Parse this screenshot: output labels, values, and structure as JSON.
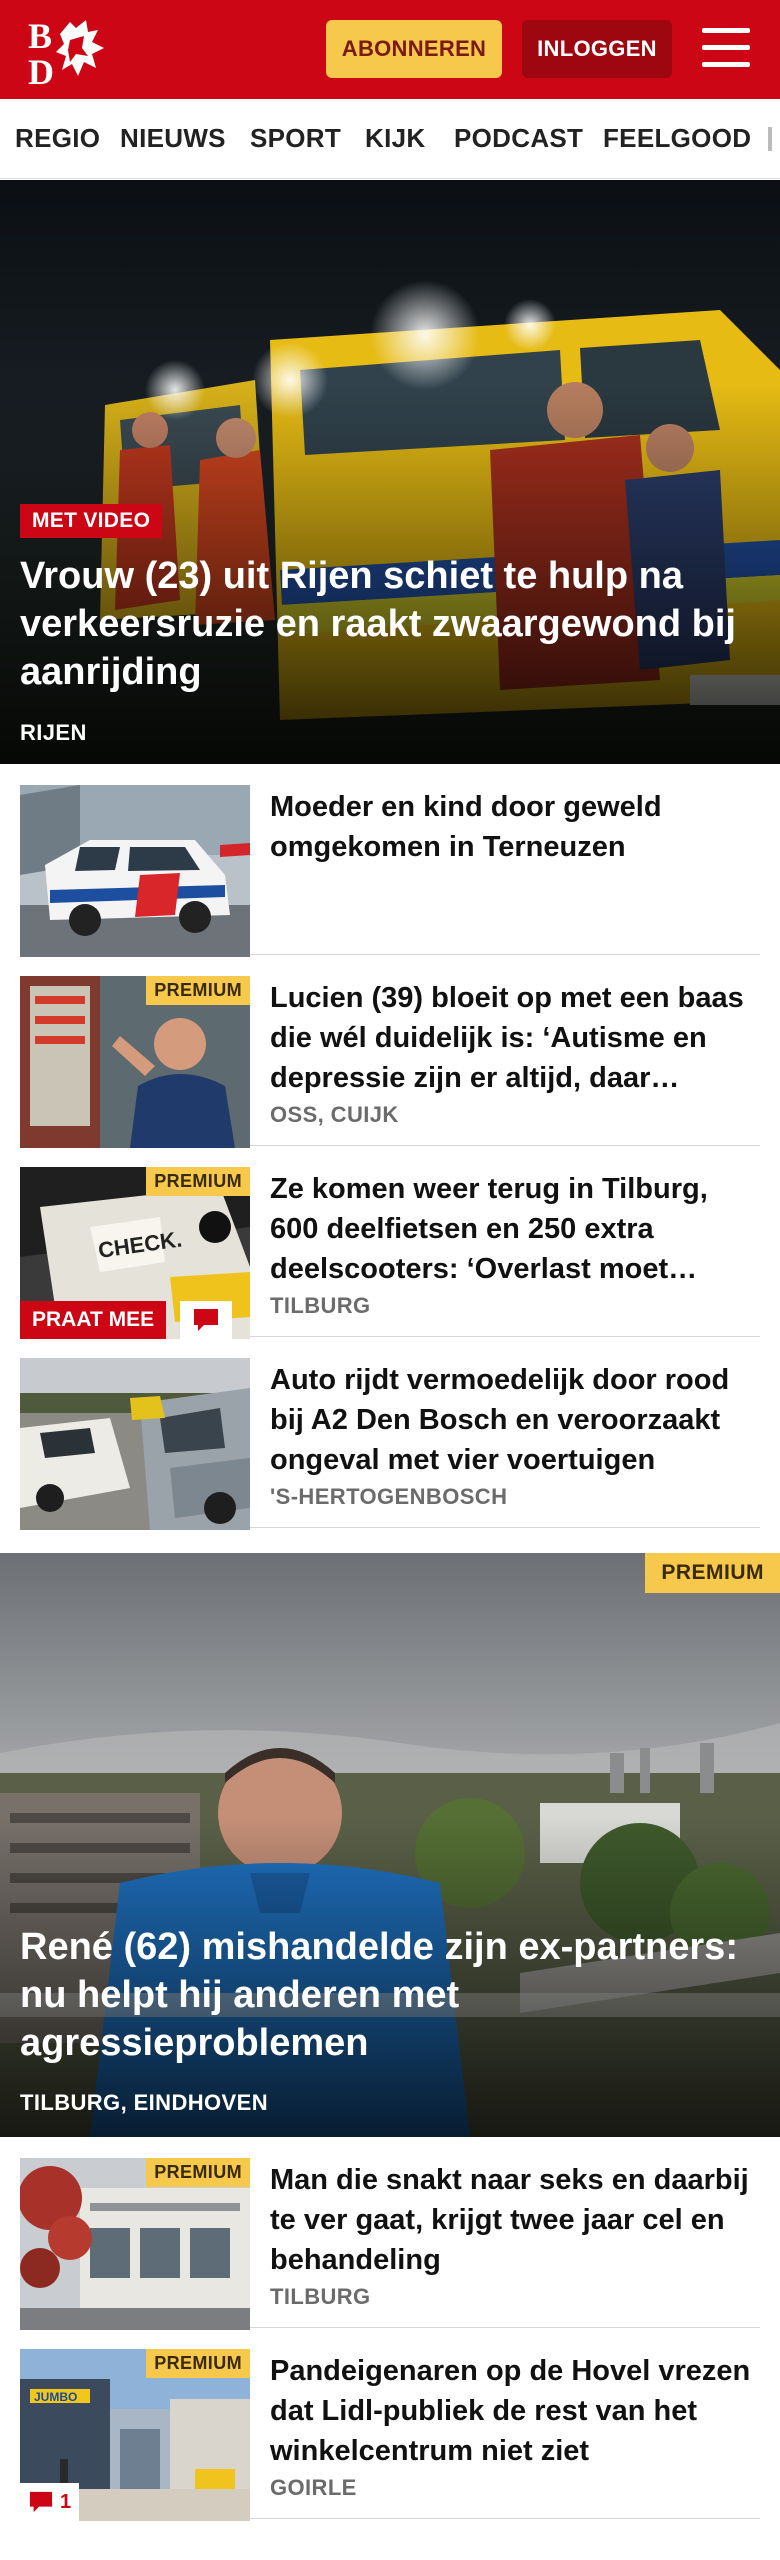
{
  "brand": {
    "logo_text_top": "B",
    "logo_text_bottom": "D",
    "primary_color": "#cc0614",
    "premium_color": "#f6c84c"
  },
  "header": {
    "subscribe_label": "ABONNEREN",
    "login_label": "INLOGGEN"
  },
  "nav": {
    "items": [
      "REGIO",
      "NIEUWS",
      "SPORT",
      "KIJK",
      "PODCAST",
      "FEELGOOD"
    ]
  },
  "hero1": {
    "badge": "MET VIDEO",
    "title": "Vrouw (23) uit Rijen schiet te hulp na verkeersruzie en raakt zwaargewond bij aanrijding",
    "location": "RIJEN"
  },
  "articles": [
    {
      "title": "Moeder en kind door geweld omgekomen in Terneuzen",
      "location": "",
      "premium": ""
    },
    {
      "title": "Lucien (39) bloeit op met een baas die wél duidelijk is: ‘Autisme en depressie zijn er altijd, daar…",
      "location": "OSS, CUIJK",
      "premium": "PREMIUM"
    },
    {
      "title": "Ze komen weer terug in Tilburg, 600 deelfietsen en 250 extra deelscooters: ‘Overlast moet…",
      "location": "TILBURG",
      "premium": "PREMIUM",
      "praat": "PRAAT MEE"
    },
    {
      "title": "Auto rijdt vermoedelijk door rood bij A2 Den Bosch en veroorzaakt ongeval met vier voertuigen",
      "location": "'S-HERTOGENBOSCH",
      "premium": ""
    }
  ],
  "hero2": {
    "premium": "PREMIUM",
    "title": "René (62) mishandelde zijn ex-part­ners: nu helpt hij anderen met agressieproblemen",
    "location": "TILBURG, EINDHOVEN"
  },
  "articles2": [
    {
      "title": "Man die snakt naar seks en daarbij te ver gaat, krijgt twee jaar cel en behandeling",
      "location": "TILBURG",
      "premium": "PREMIUM"
    },
    {
      "title": "Pandeigenaren op de Hovel vrezen dat Lidl-publiek de rest van het winkelcentrum niet ziet",
      "location": "GOIRLE",
      "premium": "PREMIUM",
      "comments": "1"
    }
  ]
}
